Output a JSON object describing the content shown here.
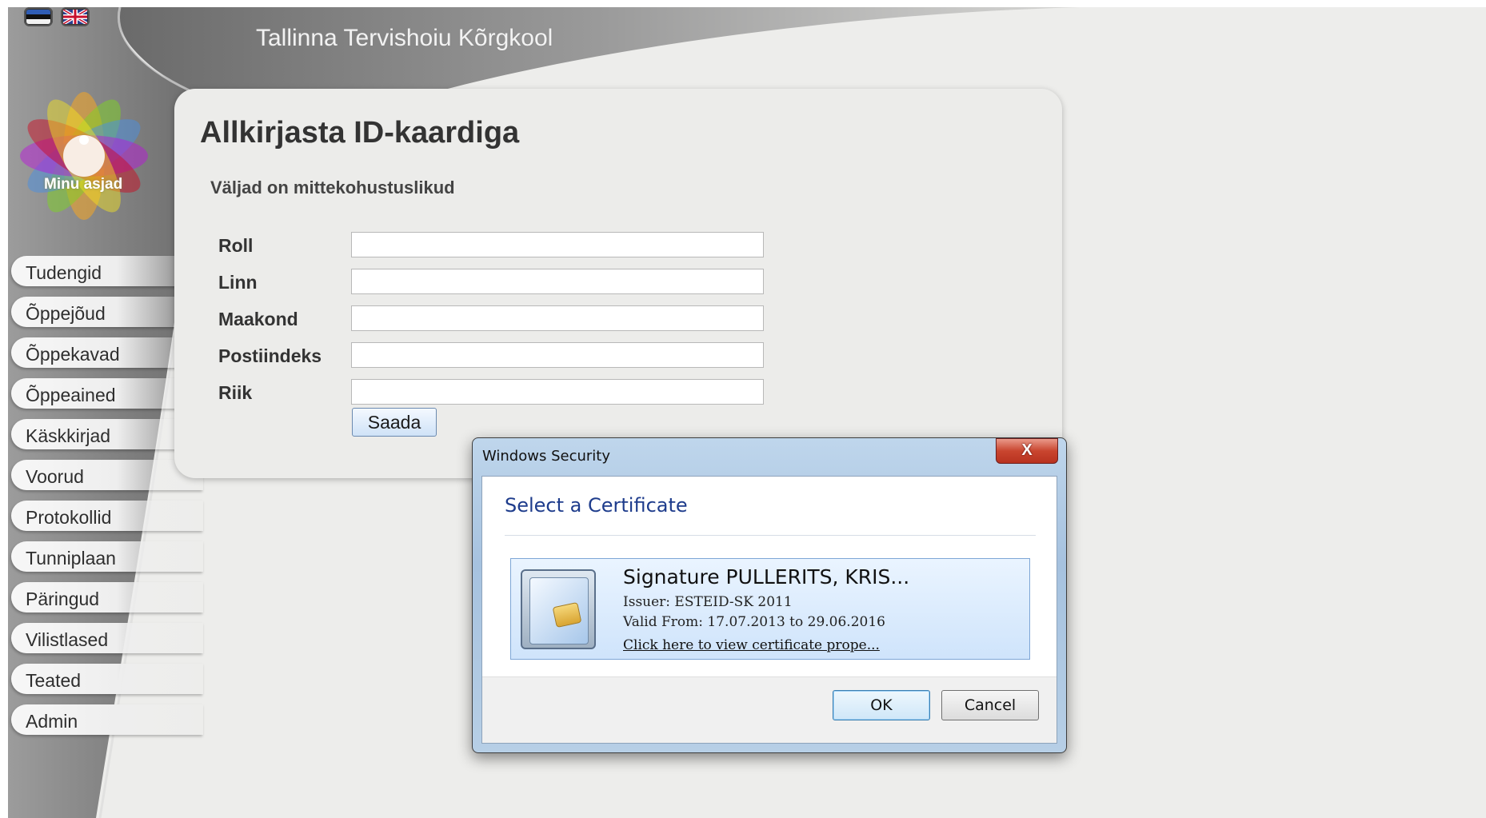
{
  "header": {
    "site_title": "Tallinna Tervishoiu Kõrgkool",
    "languages": [
      "et",
      "en"
    ]
  },
  "logo": {
    "label": "Minu asjad",
    "icon": "flower-logo-icon"
  },
  "sidebar": {
    "items": [
      {
        "label": "Tudengid"
      },
      {
        "label": "Õppejõud"
      },
      {
        "label": "Õppekavad"
      },
      {
        "label": "Õppeained"
      },
      {
        "label": "Käskkirjad"
      },
      {
        "label": "Voorud"
      },
      {
        "label": "Protokollid"
      },
      {
        "label": "Tunniplaan"
      },
      {
        "label": "Päringud"
      },
      {
        "label": "Vilistlased"
      },
      {
        "label": "Teated"
      },
      {
        "label": "Admin"
      }
    ]
  },
  "form": {
    "title": "Allkirjasta ID-kaardiga",
    "subtitle": "Väljad on mittekohustuslikud",
    "fields": [
      {
        "label": "Roll",
        "value": ""
      },
      {
        "label": "Linn",
        "value": ""
      },
      {
        "label": "Maakond",
        "value": ""
      },
      {
        "label": "Postiindeks",
        "value": ""
      },
      {
        "label": "Riik",
        "value": ""
      }
    ],
    "submit_label": "Saada"
  },
  "dialog": {
    "window_title": "Windows Security",
    "close_label": "X",
    "heading": "Select a Certificate",
    "certificate": {
      "name": "Signature PULLERITS, KRIS...",
      "issuer": "Issuer: ESTEID-SK 2011",
      "valid": "Valid From: 17.07.2013 to 29.06.2016",
      "link": "Click here to view certificate prope...",
      "icon": "smart-card-icon"
    },
    "ok_label": "OK",
    "cancel_label": "Cancel"
  },
  "colors": {
    "page_bg": "#ededeb",
    "dialog_heading": "#1e3c8c",
    "dialog_frame": "#a6c2df",
    "close_button": "#c9452f"
  }
}
